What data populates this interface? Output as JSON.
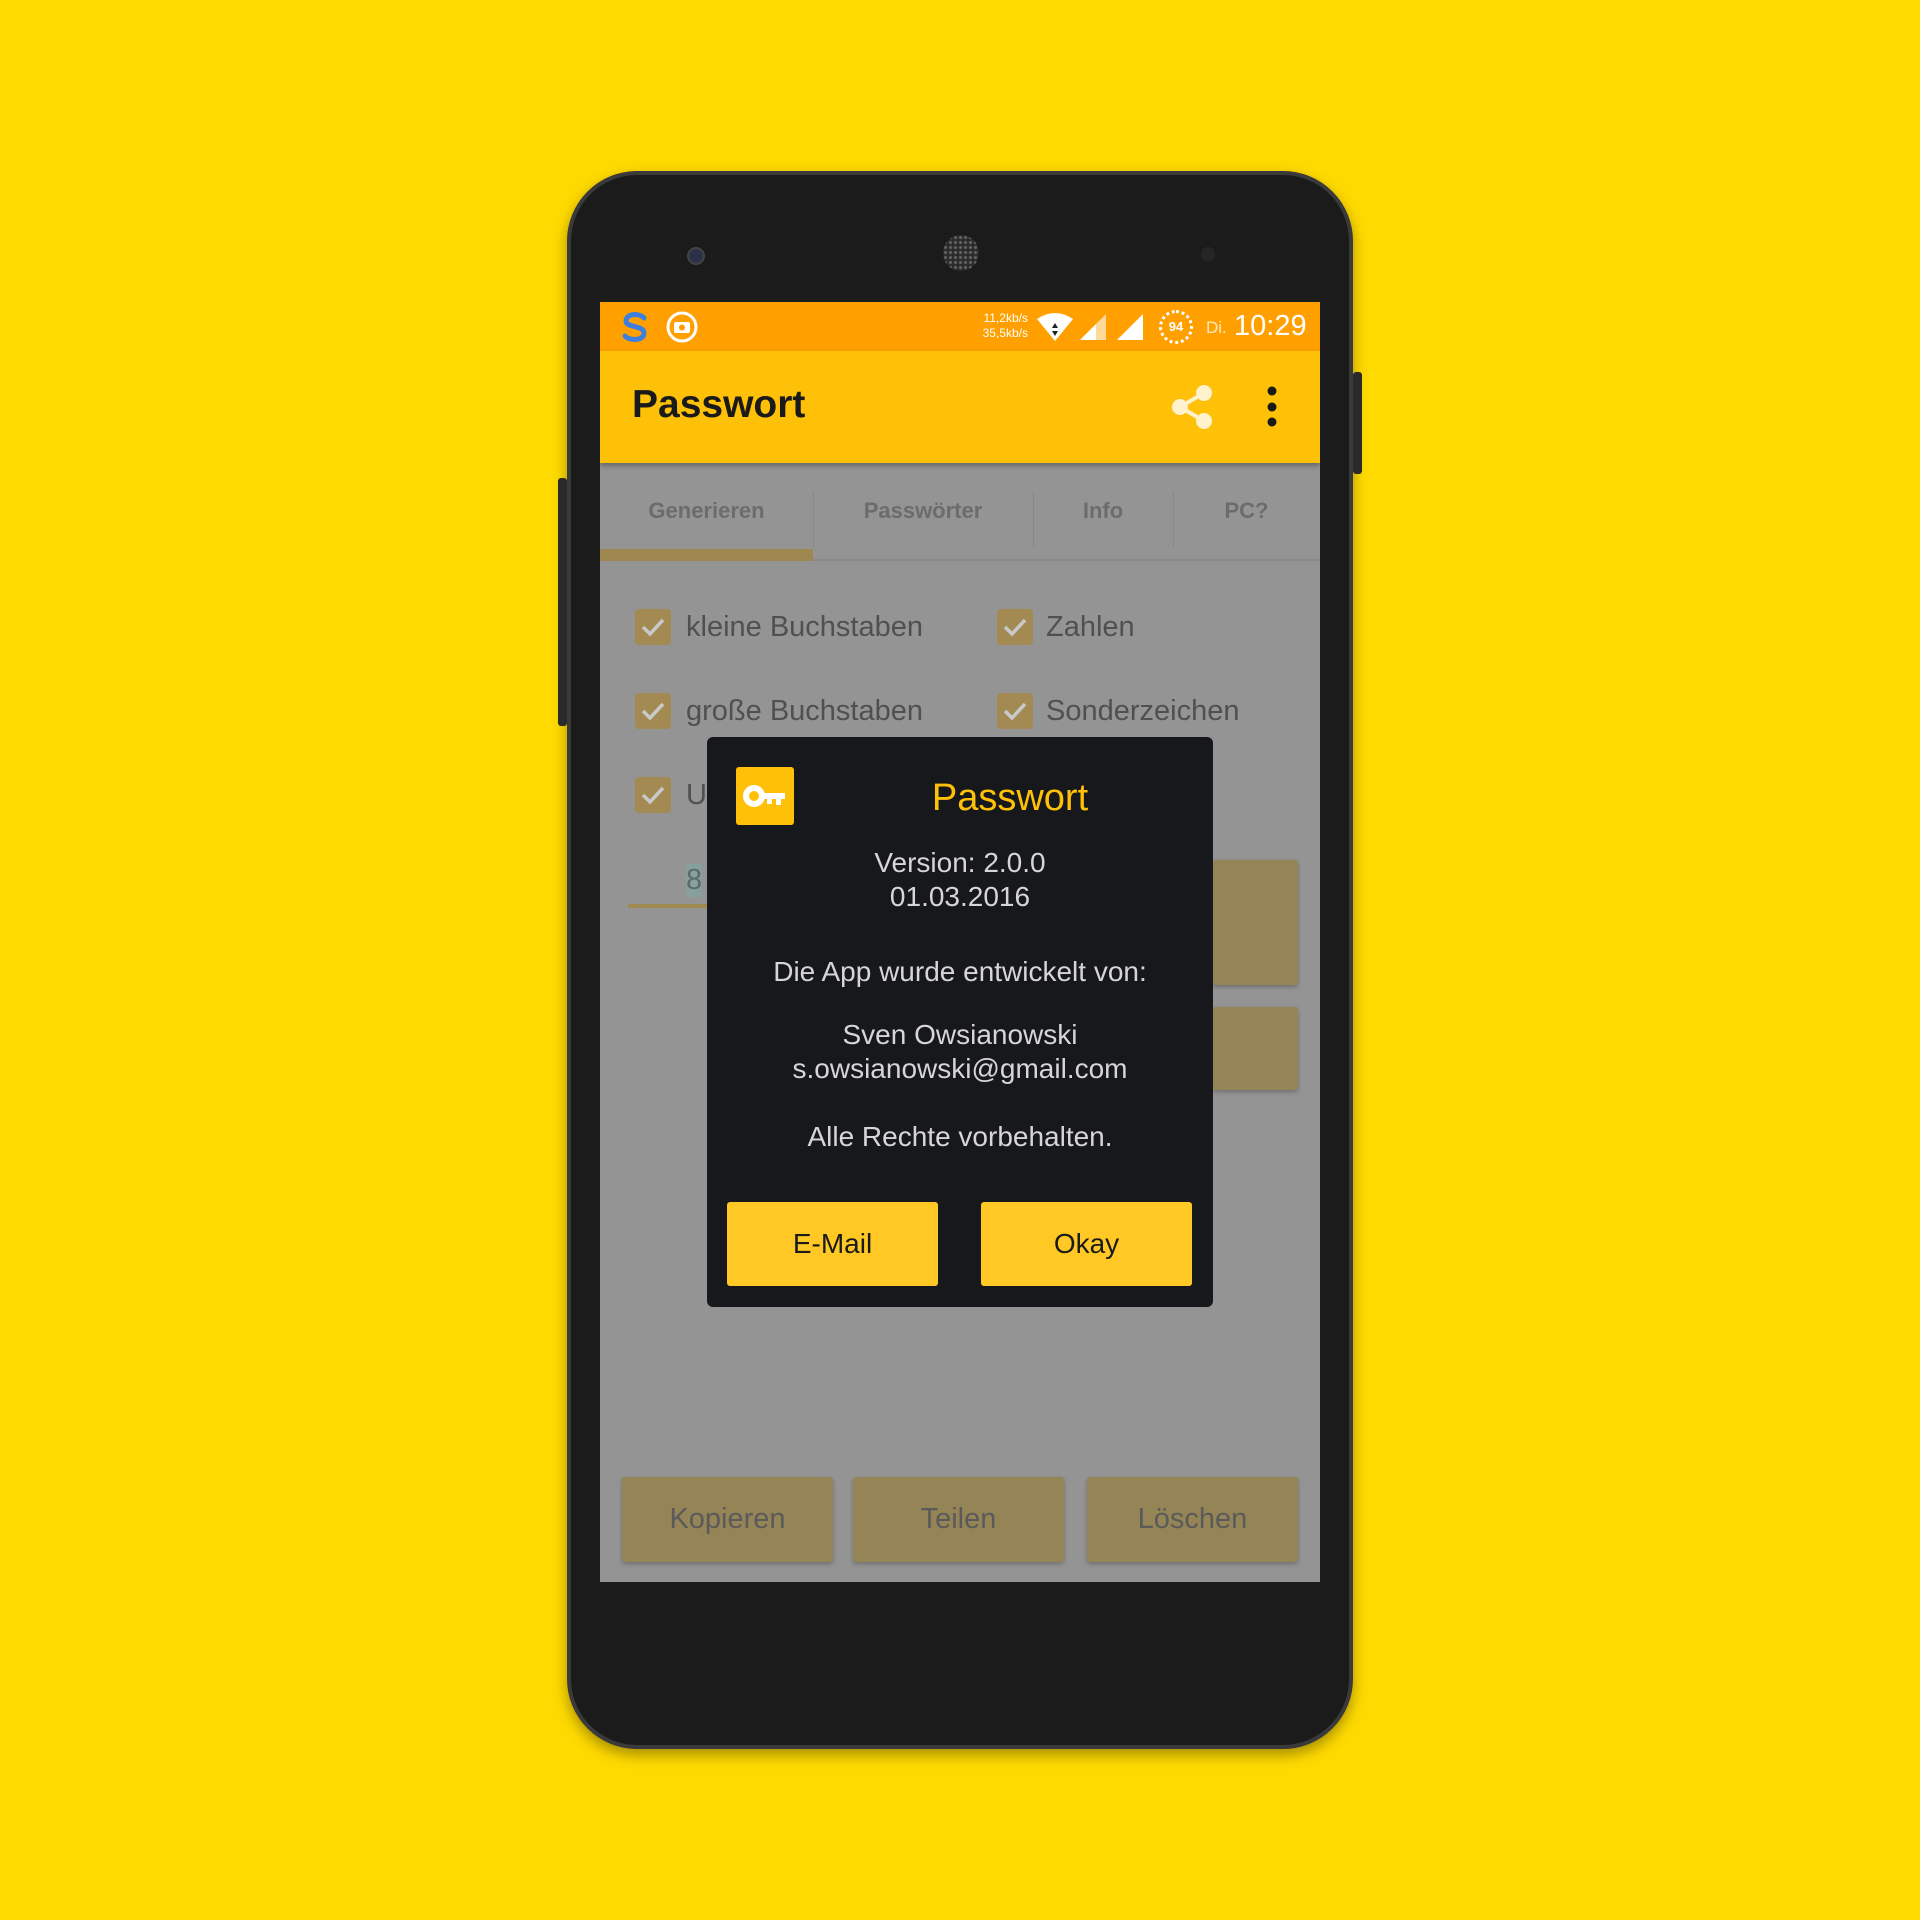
{
  "status_bar": {
    "net_up": "11,2kb/s",
    "net_down": "35,5kb/s",
    "battery": "94",
    "day": "Di.",
    "time": "10:29"
  },
  "app_bar": {
    "title": "Passwort",
    "share_icon": "share-icon",
    "menu_icon": "more-vert-icon"
  },
  "tabs": [
    {
      "label": "Generieren",
      "active": true
    },
    {
      "label": "Passwörter"
    },
    {
      "label": "Info"
    },
    {
      "label": "PC?"
    }
  ],
  "options": [
    {
      "label": "kleine Buchstaben",
      "checked": true
    },
    {
      "label": "Zahlen",
      "checked": true
    },
    {
      "label": "große Buchstaben",
      "checked": true
    },
    {
      "label": "Sonderzeichen",
      "checked": true
    },
    {
      "label": "U",
      "checked": true
    }
  ],
  "length_input": {
    "value": "8"
  },
  "bottom_buttons": {
    "copy": "Kopieren",
    "share": "Teilen",
    "delete": "Löschen"
  },
  "dialog": {
    "title": "Passwort",
    "version": "Version: 2.0.0",
    "date": "01.03.2016",
    "developed_by": "Die App wurde entwickelt von:",
    "author": "Sven Owsianowski",
    "email": "s.owsianowski@gmail.com",
    "rights": "Alle Rechte vorbehalten.",
    "email_button": "E-Mail",
    "ok_button": "Okay"
  },
  "colors": {
    "background": "#FFDA00",
    "accent": "#FFC107",
    "status_bar": "#FFA000",
    "dialog_bg": "#17181B"
  }
}
